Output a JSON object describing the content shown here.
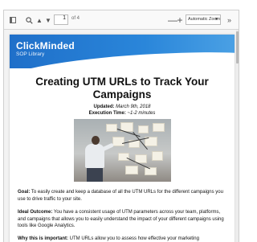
{
  "toolbar": {
    "page_number": "1",
    "page_total": "of 4",
    "zoom_label": "Automatic Zoom",
    "zoom_minus": "—",
    "zoom_plus": "+",
    "icons": [
      "sidebar-toggle-icon",
      "search-icon",
      "previous-page-icon",
      "next-page-icon",
      "zoom-out-icon",
      "zoom-in-icon",
      "more-tools-icon"
    ]
  },
  "document": {
    "brand": {
      "name": "ClickMinded",
      "subtitle": "SOP Library"
    },
    "title": "Creating UTM URLs to Track Your Campaigns",
    "updated_label": "Updated:",
    "updated_value": "March 9th, 2018",
    "execution_label": "Execution Time:",
    "execution_value": "~1-2 minutes",
    "sections": [
      {
        "label": "Goal:",
        "text": "To easily create and keep a database of all the UTM URLs for the different campaigns you use to drive traffic to your site."
      },
      {
        "label": "Ideal Outcome:",
        "text": "You have a consistent usage of UTM parameters across your team, platforms, and campaigns that allows you to easily understand the impact of your different campaigns using tools like Google Analytics."
      },
      {
        "label": "Why this is important:",
        "text": "UTM URLs allow you to assess how effective your marketing"
      }
    ]
  },
  "colors": {
    "banner": "#2a86da",
    "toolbar_bg": "#f9f9f9",
    "viewer_bg": "#f3f3f3"
  }
}
